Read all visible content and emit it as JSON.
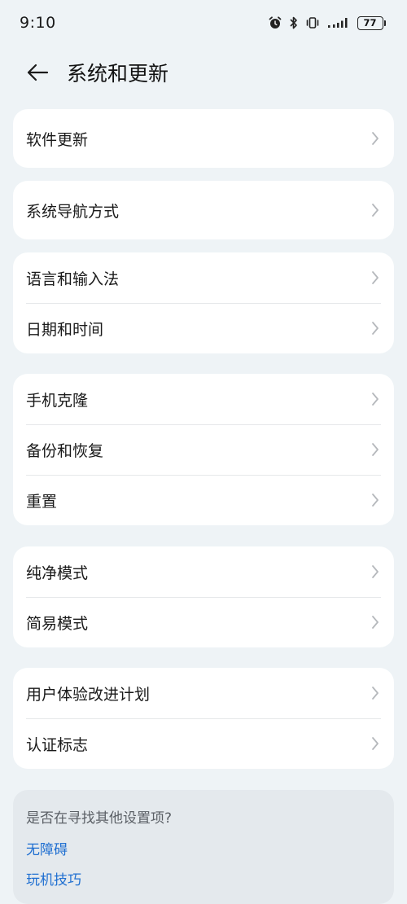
{
  "status": {
    "time": "9:10",
    "battery": "77",
    "icons": [
      "alarm-icon",
      "bluetooth-icon",
      "vibrate-icon",
      "signal-icon",
      "battery-icon"
    ]
  },
  "header": {
    "title": "系统和更新",
    "back_icon": "arrow-left-icon"
  },
  "groups": [
    {
      "items": [
        {
          "label": "软件更新"
        }
      ]
    },
    {
      "items": [
        {
          "label": "系统导航方式"
        }
      ]
    },
    {
      "items": [
        {
          "label": "语言和输入法"
        },
        {
          "label": "日期和时间"
        }
      ]
    },
    {
      "items": [
        {
          "label": "手机克隆"
        },
        {
          "label": "备份和恢复"
        },
        {
          "label": "重置"
        }
      ]
    },
    {
      "items": [
        {
          "label": "纯净模式"
        },
        {
          "label": "简易模式"
        }
      ]
    },
    {
      "items": [
        {
          "label": "用户体验改进计划"
        },
        {
          "label": "认证标志"
        }
      ]
    }
  ],
  "suggestions": {
    "title": "是否在寻找其他设置项?",
    "links": [
      {
        "label": "无障碍"
      },
      {
        "label": "玩机技巧"
      }
    ]
  },
  "colors": {
    "background": "#eef3f6",
    "card": "#ffffff",
    "link": "#1f6fd1",
    "chevron": "#b5b8bc"
  }
}
